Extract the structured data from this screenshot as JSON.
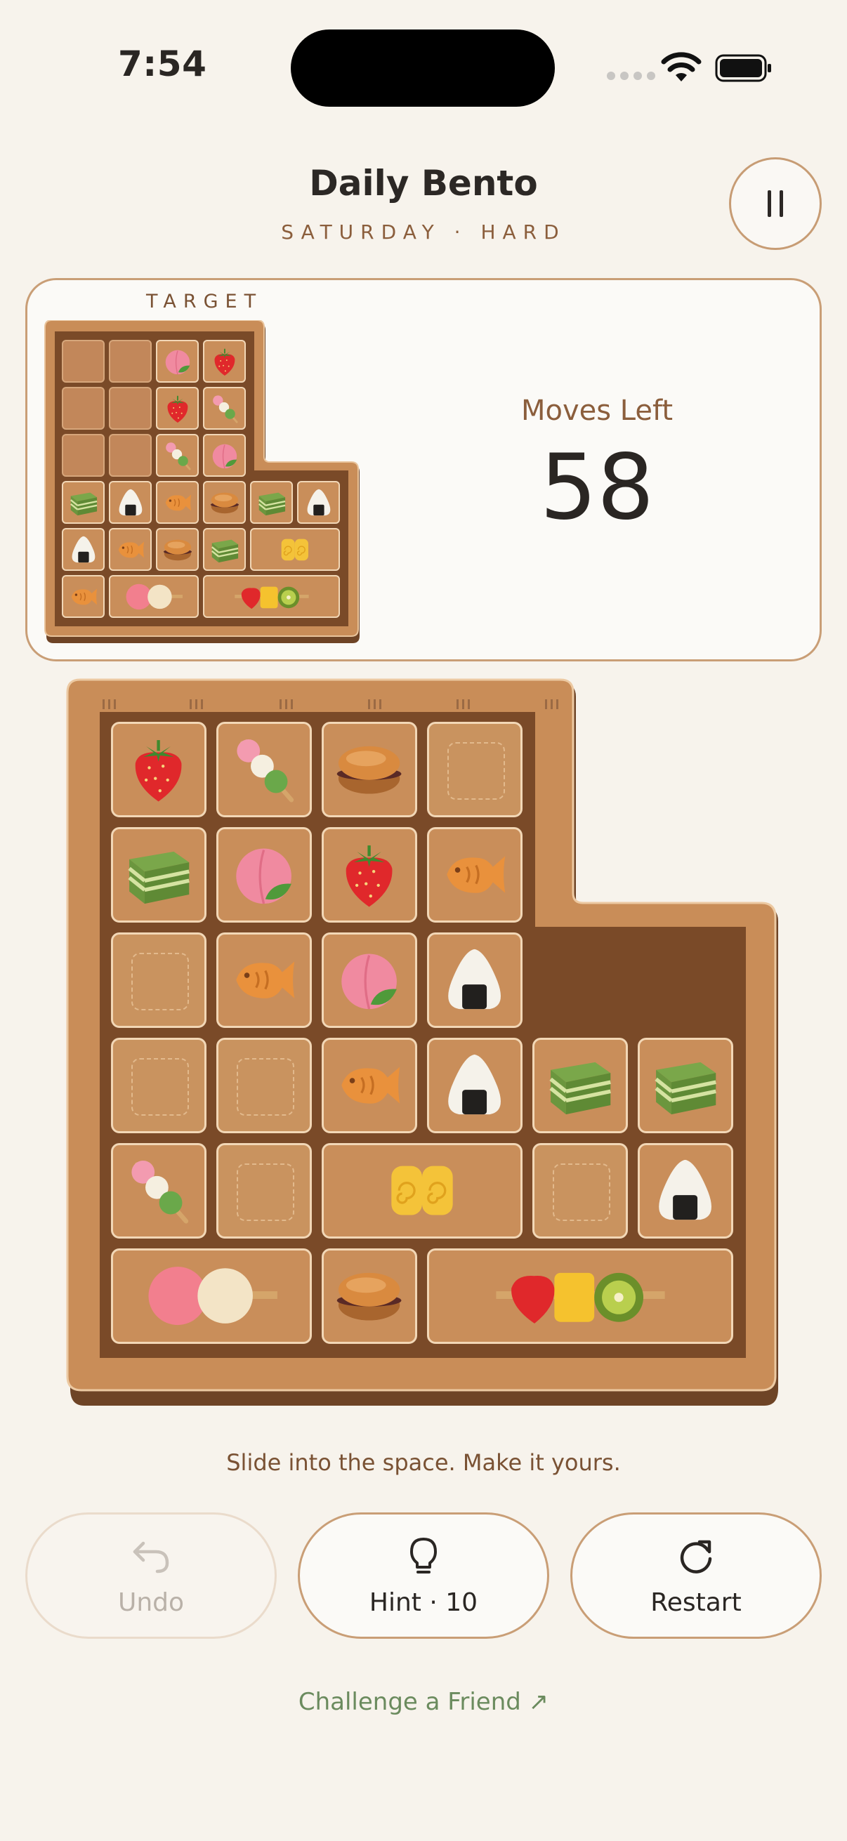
{
  "status": {
    "time": "7:54"
  },
  "header": {
    "title": "Daily Bento",
    "subtitle": "SATURDAY · HARD"
  },
  "target_card": {
    "label": "TARGET",
    "moves_label": "Moves Left",
    "moves_value": "58"
  },
  "target_board": [
    {
      "item": "empty"
    },
    {
      "item": "empty"
    },
    {
      "item": "peach"
    },
    {
      "item": "strawberry"
    },
    {
      "item": "empty"
    },
    {
      "item": "empty"
    },
    {
      "item": "strawberry"
    },
    {
      "item": "dango"
    },
    {
      "item": "empty"
    },
    {
      "item": "empty"
    },
    {
      "item": "dango"
    },
    {
      "item": "peach"
    },
    {
      "item": "matcha-cake"
    },
    {
      "item": "onigiri"
    },
    {
      "item": "taiyaki"
    },
    {
      "item": "dorayaki"
    },
    {
      "item": "matcha-cake"
    },
    {
      "item": "onigiri"
    },
    {
      "item": "onigiri"
    },
    {
      "item": "taiyaki"
    },
    {
      "item": "dorayaki"
    },
    {
      "item": "matcha-cake"
    },
    {
      "item": "tamagoyaki"
    },
    {
      "item": "taiyaki"
    },
    {
      "item": "big-dango"
    },
    {
      "item": "fruit-skewer"
    }
  ],
  "game_board": [
    {
      "item": "strawberry"
    },
    {
      "item": "dango"
    },
    {
      "item": "dorayaki"
    },
    {
      "item": "empty"
    },
    {
      "item": "matcha-cake"
    },
    {
      "item": "peach"
    },
    {
      "item": "strawberry"
    },
    {
      "item": "taiyaki"
    },
    {
      "item": "empty"
    },
    {
      "item": "taiyaki"
    },
    {
      "item": "peach"
    },
    {
      "item": "onigiri"
    },
    {
      "item": "empty"
    },
    {
      "item": "empty"
    },
    {
      "item": "taiyaki"
    },
    {
      "item": "onigiri"
    },
    {
      "item": "matcha-cake"
    },
    {
      "item": "matcha-cake"
    },
    {
      "item": "dango"
    },
    {
      "item": "empty"
    },
    {
      "item": "tamagoyaki"
    },
    {
      "item": "empty"
    },
    {
      "item": "onigiri"
    },
    {
      "item": "big-dango"
    },
    {
      "item": "dorayaki"
    },
    {
      "item": "fruit-skewer"
    }
  ],
  "hint_text": "Slide into the space. Make it yours.",
  "buttons": {
    "undo": {
      "label": "Undo",
      "icon": "undo-icon",
      "enabled": false
    },
    "hint": {
      "label": "Hint · 10",
      "icon": "lightbulb-icon"
    },
    "restart": {
      "label": "Restart",
      "icon": "restart-icon"
    }
  },
  "challenge_link": "Challenge a Friend ↗",
  "colors": {
    "background": "#f7f3ec",
    "accent": "#c99e76",
    "wood": "#c98e5a",
    "link": "#6b8b5e"
  }
}
